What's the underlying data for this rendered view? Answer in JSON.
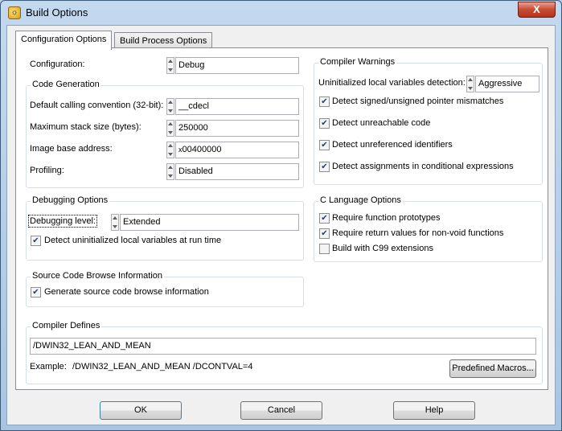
{
  "window": {
    "title": "Build Options",
    "close_glyph": "X"
  },
  "tabs": [
    {
      "label": "Configuration Options",
      "active": true
    },
    {
      "label": "Build Process Options",
      "active": false
    }
  ],
  "configuration": {
    "label": "Configuration:",
    "value": "Debug"
  },
  "code_generation": {
    "title": "Code Generation",
    "calling_convention": {
      "label": "Default calling convention (32-bit):",
      "value": "__cdecl"
    },
    "stack_size": {
      "label": "Maximum stack size (bytes):",
      "value": "250000"
    },
    "image_base": {
      "label": "Image base address:",
      "prefix": "x",
      "value": "00400000"
    },
    "profiling": {
      "label": "Profiling:",
      "value": "Disabled"
    }
  },
  "debugging": {
    "title": "Debugging Options",
    "level": {
      "label": "Debugging level:",
      "value": "Extended"
    },
    "detect_uninit": {
      "label": "Detect uninitialized local variables at run time",
      "checked": true
    }
  },
  "browse": {
    "title": "Source Code Browse Information",
    "generate": {
      "label": "Generate source code browse information",
      "checked": true
    }
  },
  "compiler_warnings": {
    "title": "Compiler Warnings",
    "detection": {
      "label": "Uninitialized local variables detection:",
      "value": "Aggressive"
    },
    "checks": [
      {
        "label": "Detect signed/unsigned pointer mismatches",
        "checked": true
      },
      {
        "label": "Detect unreachable code",
        "checked": true
      },
      {
        "label": "Detect unreferenced identifiers",
        "checked": true
      },
      {
        "label": "Detect assignments in conditional expressions",
        "checked": true
      }
    ]
  },
  "c_language": {
    "title": "C Language Options",
    "checks": [
      {
        "label": "Require function prototypes",
        "checked": true
      },
      {
        "label": "Require return values for non-void functions",
        "checked": true
      },
      {
        "label": "Build with C99 extensions",
        "checked": false
      }
    ]
  },
  "defines": {
    "title": "Compiler Defines",
    "value": "/DWIN32_LEAN_AND_MEAN",
    "example_label": "Example:",
    "example_value": "/DWIN32_LEAN_AND_MEAN  /DCONTVAL=4",
    "predefined_button": "Predefined Macros..."
  },
  "buttons": {
    "ok": "OK",
    "cancel": "Cancel",
    "help": "Help"
  },
  "icons": {
    "app": "lightbulb-icon",
    "check": "checkmark-icon",
    "spin": "spin-arrows-icon"
  }
}
